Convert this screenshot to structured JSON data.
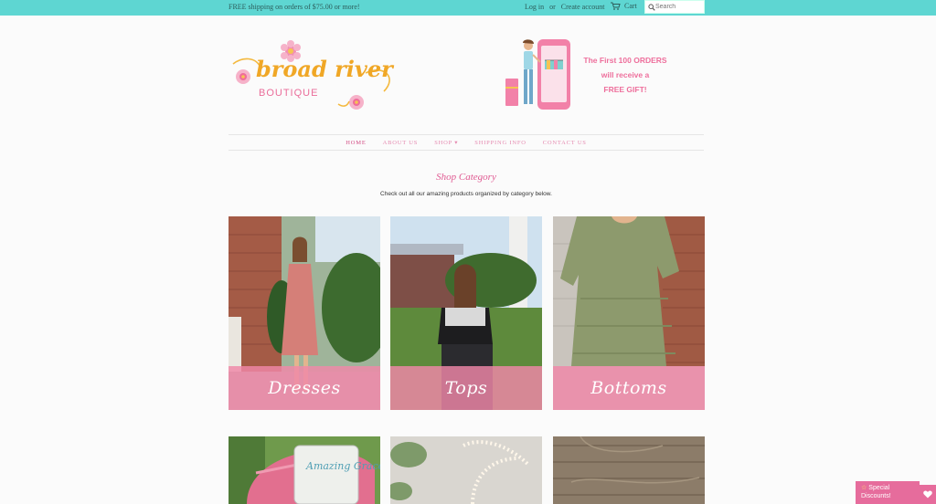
{
  "topbar": {
    "shipping_text": "FREE shipping on orders of $75.00 or more!",
    "login": "Log in",
    "or": "or",
    "create_account": "Create account",
    "cart": "Cart",
    "search_placeholder": "Search"
  },
  "logo": {
    "line1": "broad river",
    "line2": "BOUTIQUE"
  },
  "promo": {
    "line1": "The First 100 ORDERS",
    "line2": "will receive a",
    "line3": "FREE GIFT!"
  },
  "nav": {
    "items": [
      {
        "label": "HOME"
      },
      {
        "label": "ABOUT US"
      },
      {
        "label": "SHOP ▾"
      },
      {
        "label": "SHIPPING INFO"
      },
      {
        "label": "CONTACT US"
      }
    ]
  },
  "main": {
    "heading": "Shop Category",
    "subheading": "Check out all our amazing products organized by category below."
  },
  "categories": [
    {
      "label": "Dresses"
    },
    {
      "label": "Tops"
    },
    {
      "label": "Bottoms"
    }
  ],
  "hat_text": "Amazing Grace",
  "badge": {
    "label": "Special Discounts!"
  },
  "colors": {
    "topbar": "#5ed6d2",
    "accent_pink": "#e66c9c",
    "label_overlay": "#f087a8"
  }
}
